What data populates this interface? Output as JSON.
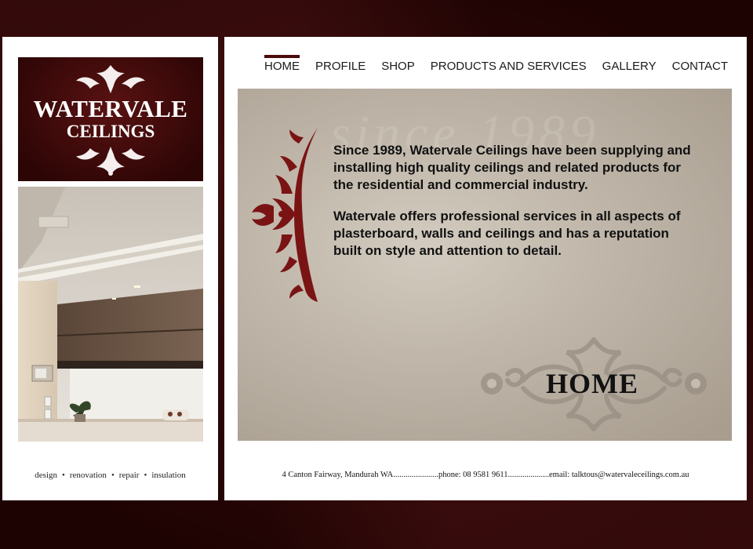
{
  "brand": {
    "line1": "WATERVALE",
    "line2": "CEILINGS",
    "tagline": [
      "design",
      "renovation",
      "repair",
      "insulation"
    ]
  },
  "nav": {
    "items": [
      {
        "label": "HOME",
        "active": true
      },
      {
        "label": "PROFILE",
        "active": false
      },
      {
        "label": "SHOP",
        "active": false
      },
      {
        "label": "PRODUCTS AND SERVICES",
        "active": false
      },
      {
        "label": "GALLERY",
        "active": false
      },
      {
        "label": "CONTACT",
        "active": false
      }
    ]
  },
  "hero": {
    "watermark": "since 1989",
    "paragraph1": "Since 1989, Watervale Ceilings have been supplying and installing high quality ceilings and related products for the residential and commercial industry.",
    "paragraph2": "Watervale offers professional services in all aspects of plasterboard, walls and ceilings and has a reputation built on style and attention to detail.",
    "title": "HOME"
  },
  "footer": {
    "text": "4 Canton Fairway, Mandurah WA......................phone: 08 9581 9611....................email: talktous@watervaleceilings.com.au"
  },
  "colors": {
    "accent": "#4a0b0b",
    "ornament": "#7a1414",
    "background": "#2a0606"
  }
}
